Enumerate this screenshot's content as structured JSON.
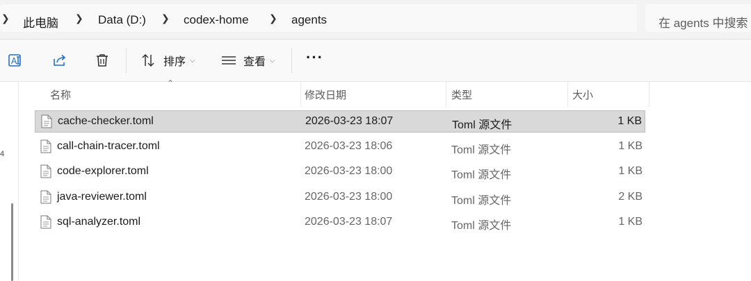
{
  "address": {
    "crumbs": [
      "此电脑",
      "Data (D:)",
      "codex-home",
      "agents"
    ],
    "search_placeholder": "在 agents 中搜索"
  },
  "toolbar": {
    "sort_label": "排序",
    "view_label": "查看",
    "more_label": "···"
  },
  "nav": {
    "fragment": "4"
  },
  "columns": {
    "name": "名称",
    "date": "修改日期",
    "type": "类型",
    "size": "大小"
  },
  "files": [
    {
      "name": "cache-checker.toml",
      "date": "2026-03-23 18:07",
      "type": "Toml 源文件",
      "size": "1 KB",
      "selected": true
    },
    {
      "name": "call-chain-tracer.toml",
      "date": "2026-03-23 18:06",
      "type": "Toml 源文件",
      "size": "1 KB",
      "selected": false
    },
    {
      "name": "code-explorer.toml",
      "date": "2026-03-23 18:00",
      "type": "Toml 源文件",
      "size": "1 KB",
      "selected": false
    },
    {
      "name": "java-reviewer.toml",
      "date": "2026-03-23 18:00",
      "type": "Toml 源文件",
      "size": "2 KB",
      "selected": false
    },
    {
      "name": "sql-analyzer.toml",
      "date": "2026-03-23 18:07",
      "type": "Toml 源文件",
      "size": "1 KB",
      "selected": false
    }
  ]
}
